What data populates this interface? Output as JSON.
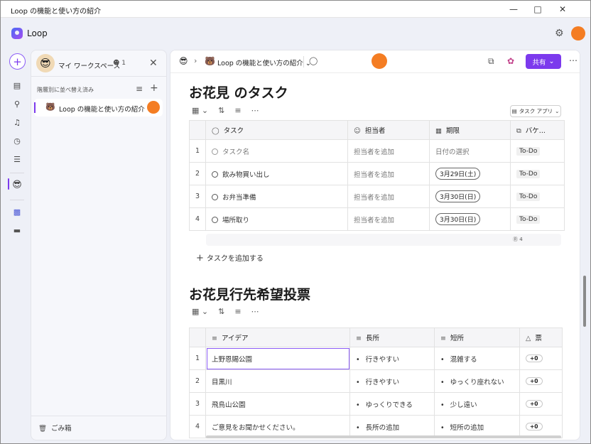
{
  "window": {
    "title": "Loop の機能と使い方の紹介"
  },
  "app": {
    "name": "Loop"
  },
  "workspace": {
    "name": "マイ ワークスペース",
    "member_count": "1",
    "sort_label": "階層別に並べ替え済み",
    "page_title": "Loop の機能と使い方の紹介",
    "trash_label": "ごみ箱"
  },
  "toolbar": {
    "page_title": "Loop の機能と使い方の紹介",
    "share_label": "共有"
  },
  "task_section": {
    "heading": "お花見 のタスク",
    "app_pill": "タスク アプリ",
    "columns": [
      "タスク",
      "担当者",
      "期限",
      "バケ..."
    ],
    "rows": [
      {
        "num": "1",
        "task": "タスク名",
        "assignee": "担当者を追加",
        "due": "日付の選択",
        "bucket": "To-Do"
      },
      {
        "num": "2",
        "task": "飲み物買い出し",
        "assignee": "担当者を追加",
        "due": "3月29日(土)",
        "bucket": "To-Do"
      },
      {
        "num": "3",
        "task": "お弁当準備",
        "assignee": "担当者を追加",
        "due": "3月30日(日)",
        "bucket": "To-Do"
      },
      {
        "num": "4",
        "task": "場所取り",
        "assignee": "担当者を追加",
        "due": "3月30日(日)",
        "bucket": "To-Do"
      }
    ],
    "footer_count": "4",
    "add_task_label": "タスクを追加する"
  },
  "vote_section": {
    "heading": "お花見行先希望投票",
    "columns": [
      "アイデア",
      "長所",
      "短所",
      "票"
    ],
    "rows": [
      {
        "num": "1",
        "idea": "上野恩賜公園",
        "pro": "行きやすい",
        "con": "混雑する",
        "vote": "+0"
      },
      {
        "num": "2",
        "idea": "目黒川",
        "pro": "行きやすい",
        "con": "ゆっくり座れない",
        "vote": "+0"
      },
      {
        "num": "3",
        "idea": "飛鳥山公園",
        "pro": "ゆっくりできる",
        "con": "少し遠い",
        "vote": "+0"
      },
      {
        "num": "4",
        "idea": "ご意見をお聞かせください。",
        "pro": "長所の追加",
        "con": "短所の追加",
        "vote": "+0"
      }
    ]
  }
}
